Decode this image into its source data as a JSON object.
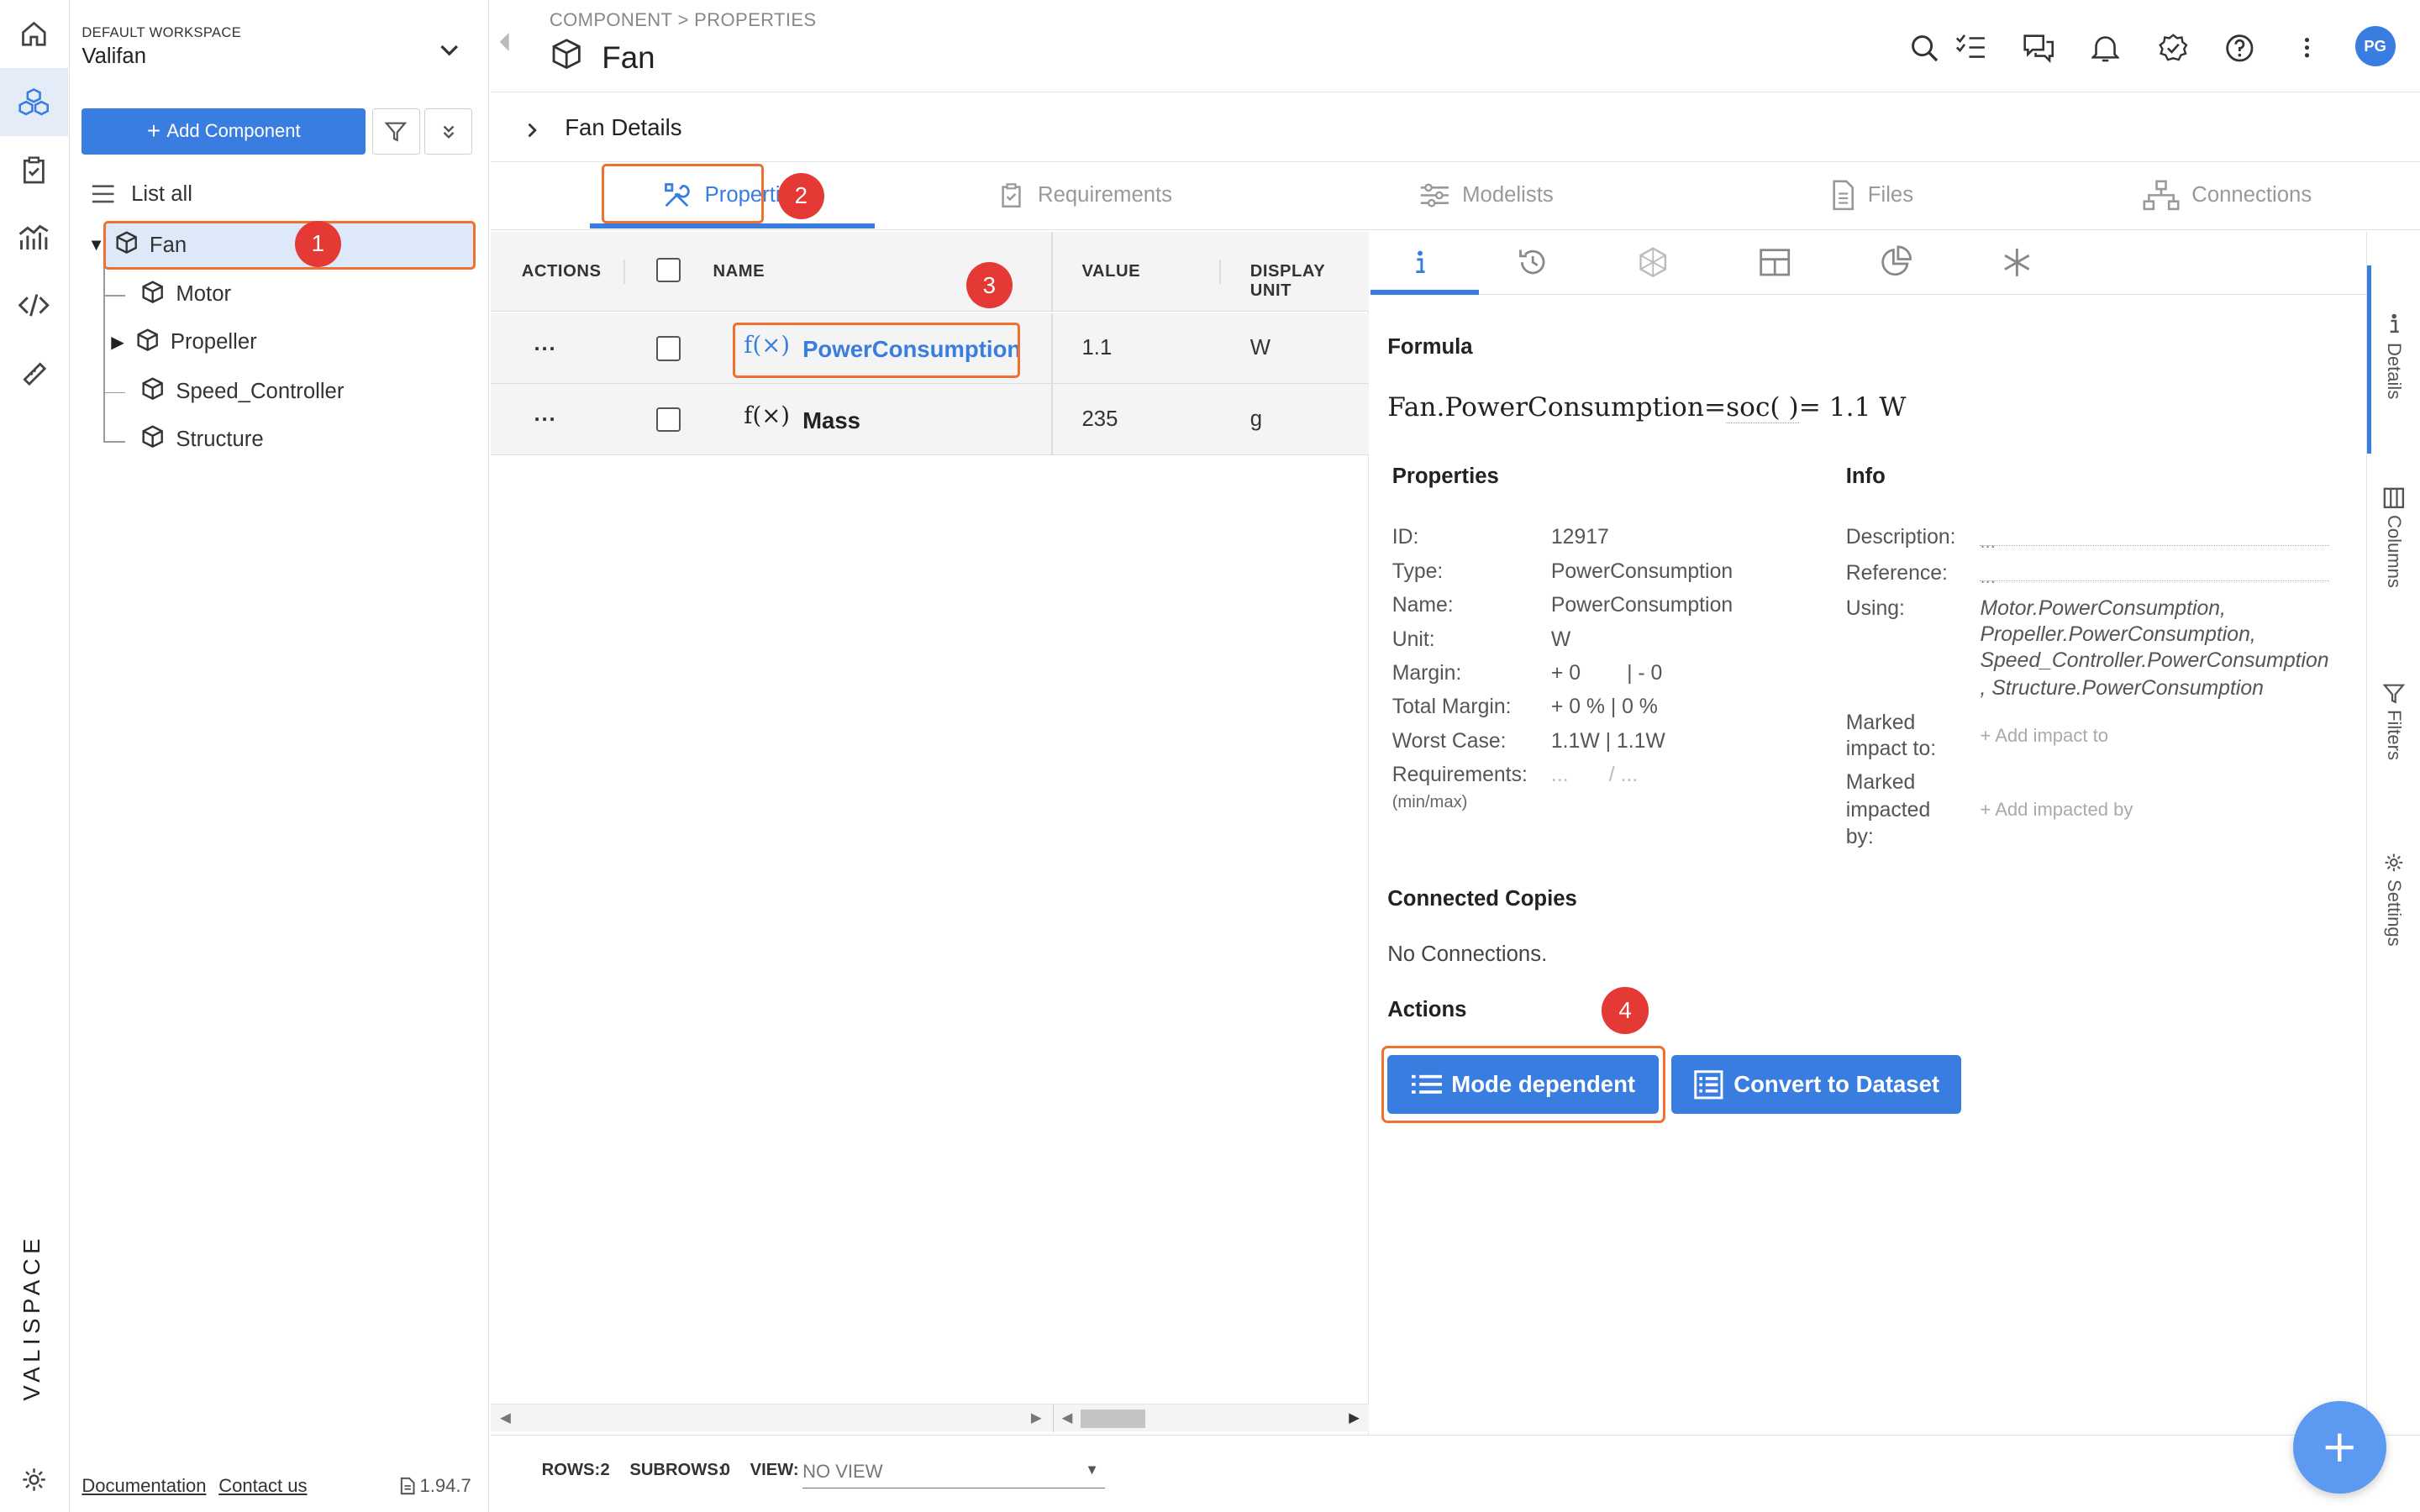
{
  "workspace": {
    "label": "DEFAULT WORKSPACE",
    "name": "Valifan"
  },
  "brand": {
    "text": "VALISPACE"
  },
  "sidebar": {
    "add_label": "Add Component",
    "list_all": "List all",
    "tree": [
      {
        "label": "Fan"
      },
      {
        "label": "Motor"
      },
      {
        "label": "Propeller"
      },
      {
        "label": "Speed_Controller"
      },
      {
        "label": "Structure"
      }
    ],
    "footer": {
      "documentation": "Documentation",
      "contact": "Contact us",
      "version": "1.94.7"
    }
  },
  "header": {
    "breadcrumb": "COMPONENT > PROPERTIES",
    "title": "Fan",
    "avatar": "PG"
  },
  "details": {
    "title": "Fan Details"
  },
  "tabs": [
    {
      "label": "Properties"
    },
    {
      "label": "Requirements"
    },
    {
      "label": "Modelists"
    },
    {
      "label": "Files"
    },
    {
      "label": "Connections"
    }
  ],
  "markers": [
    "1",
    "2",
    "3",
    "4"
  ],
  "grid": {
    "headers": {
      "actions": "ACTIONS",
      "name": "NAME",
      "value": "VALUE",
      "unit": "DISPLAY UNIT"
    },
    "rows": [
      {
        "actions": "...",
        "name": "PowerConsumption",
        "value": "1.1",
        "unit": "W"
      },
      {
        "actions": "...",
        "name": "Mass",
        "value": "235",
        "unit": "g"
      }
    ],
    "func_glyph": "f(×)"
  },
  "footer": {
    "rows_label": "ROWS:",
    "rows": "2",
    "subrows_label": "SUBROWS:",
    "subrows": "0",
    "view_label": "VIEW:",
    "view_value": "NO VIEW"
  },
  "panel": {
    "formula_title": "Formula",
    "formula_left": "Fan.PowerConsumption=",
    "formula_func": "soc( )",
    "formula_right": "= 1.1 W",
    "properties_title": "Properties",
    "properties": [
      {
        "k": "ID:",
        "v": "12917"
      },
      {
        "k": "Type:",
        "v": "PowerConsumption"
      },
      {
        "k": "Name:",
        "v": "PowerConsumption"
      },
      {
        "k": "Unit:",
        "v": "W"
      },
      {
        "k": "Margin:",
        "v": "+ 0        | - 0"
      },
      {
        "k": "Total Margin:",
        "v": "+ 0 % | 0 %"
      },
      {
        "k": "Worst Case:",
        "v": "1.1W | 1.1W"
      },
      {
        "k": "Requirements:",
        "v": "...       / ..."
      }
    ],
    "minmax": "(min/max)",
    "info_title": "Info",
    "info": {
      "description_k": "Description:",
      "description_v": "...",
      "reference_k": "Reference:",
      "reference_v": "...",
      "using_k": "Using:",
      "using_lines": [
        "Motor.PowerConsumption,",
        "Propeller.PowerConsumption,",
        "Speed_Controller.PowerConsumption",
        ", Structure.PowerConsumption"
      ],
      "impact_to_k1": "Marked",
      "impact_to_k2": "impact to:",
      "impact_to_v": "+ Add impact to",
      "impacted_by_k1": "Marked",
      "impacted_by_k2": "impacted",
      "impacted_by_k3": "by:",
      "impacted_by_v": "+ Add impacted by"
    },
    "connected_title": "Connected Copies",
    "connected_text": "No Connections.",
    "actions_title": "Actions",
    "mode_button": "Mode dependent",
    "convert_button": "Convert to Dataset"
  },
  "right_rail": [
    {
      "label": "Details"
    },
    {
      "label": "Columns"
    },
    {
      "label": "Filters"
    },
    {
      "label": "Settings"
    }
  ],
  "colors": {
    "accent": "#3a7de0",
    "highlight": "#f07030",
    "marker": "#e53935"
  }
}
